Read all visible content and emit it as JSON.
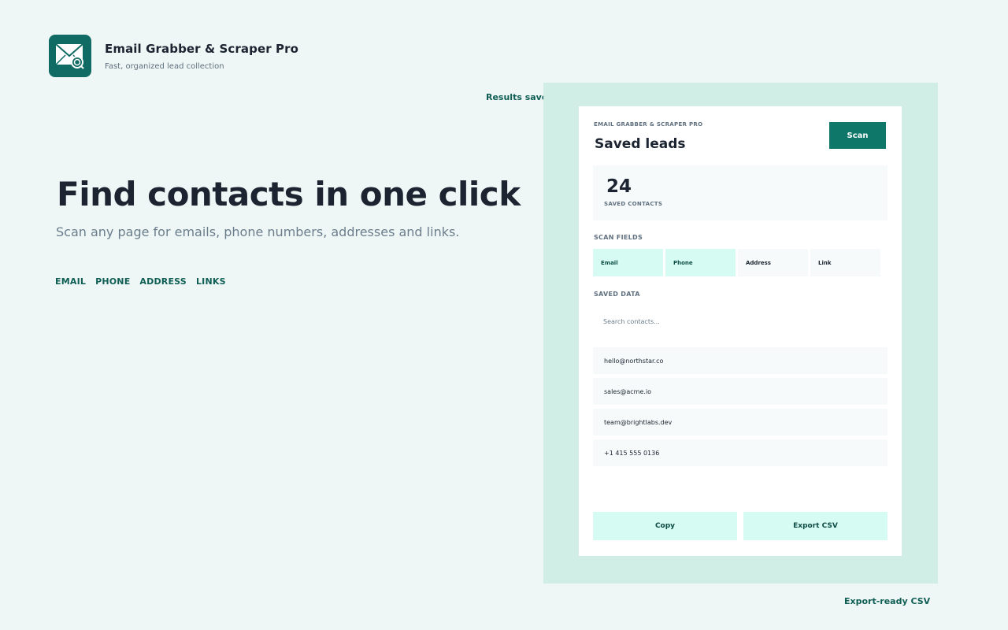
{
  "brand": {
    "title": "Email Grabber & Scraper Pro",
    "subtitle": "Fast, organized lead collection",
    "logo_icon": "envelope-search-icon",
    "accent_color": "#0f6b63"
  },
  "hero": {
    "title": "Find contacts in one click",
    "subtitle": "Scan any page for emails, phone numbers, addresses and links.",
    "features": [
      "EMAIL",
      "PHONE",
      "ADDRESS",
      "LINKS"
    ]
  },
  "captions": {
    "top": "Results saved locally",
    "bottom": "Export-ready CSV"
  },
  "popup": {
    "eyebrow": "EMAIL GRABBER & SCRAPER PRO",
    "title": "Saved leads",
    "scan_label": "Scan",
    "stats": {
      "value": "24",
      "label": "SAVED CONTACTS"
    },
    "scan_fields_label": "SCAN FIELDS",
    "fields": [
      {
        "label": "Email",
        "active": true
      },
      {
        "label": "Phone",
        "active": true
      },
      {
        "label": "Address",
        "active": false
      },
      {
        "label": "Link",
        "active": false
      }
    ],
    "saved_data_label": "SAVED DATA",
    "search_placeholder": "Search contacts...",
    "items": [
      "hello@northstar.co",
      "sales@acme.io",
      "team@brightlabs.dev",
      "+1 415 555 0136"
    ],
    "copy_label": "Copy",
    "export_label": "Export CSV"
  },
  "colors": {
    "background": "#eef7f5",
    "frame": "#d0ede6",
    "primary_button": "#0f766a",
    "chip_active": "#d5fbf3"
  }
}
